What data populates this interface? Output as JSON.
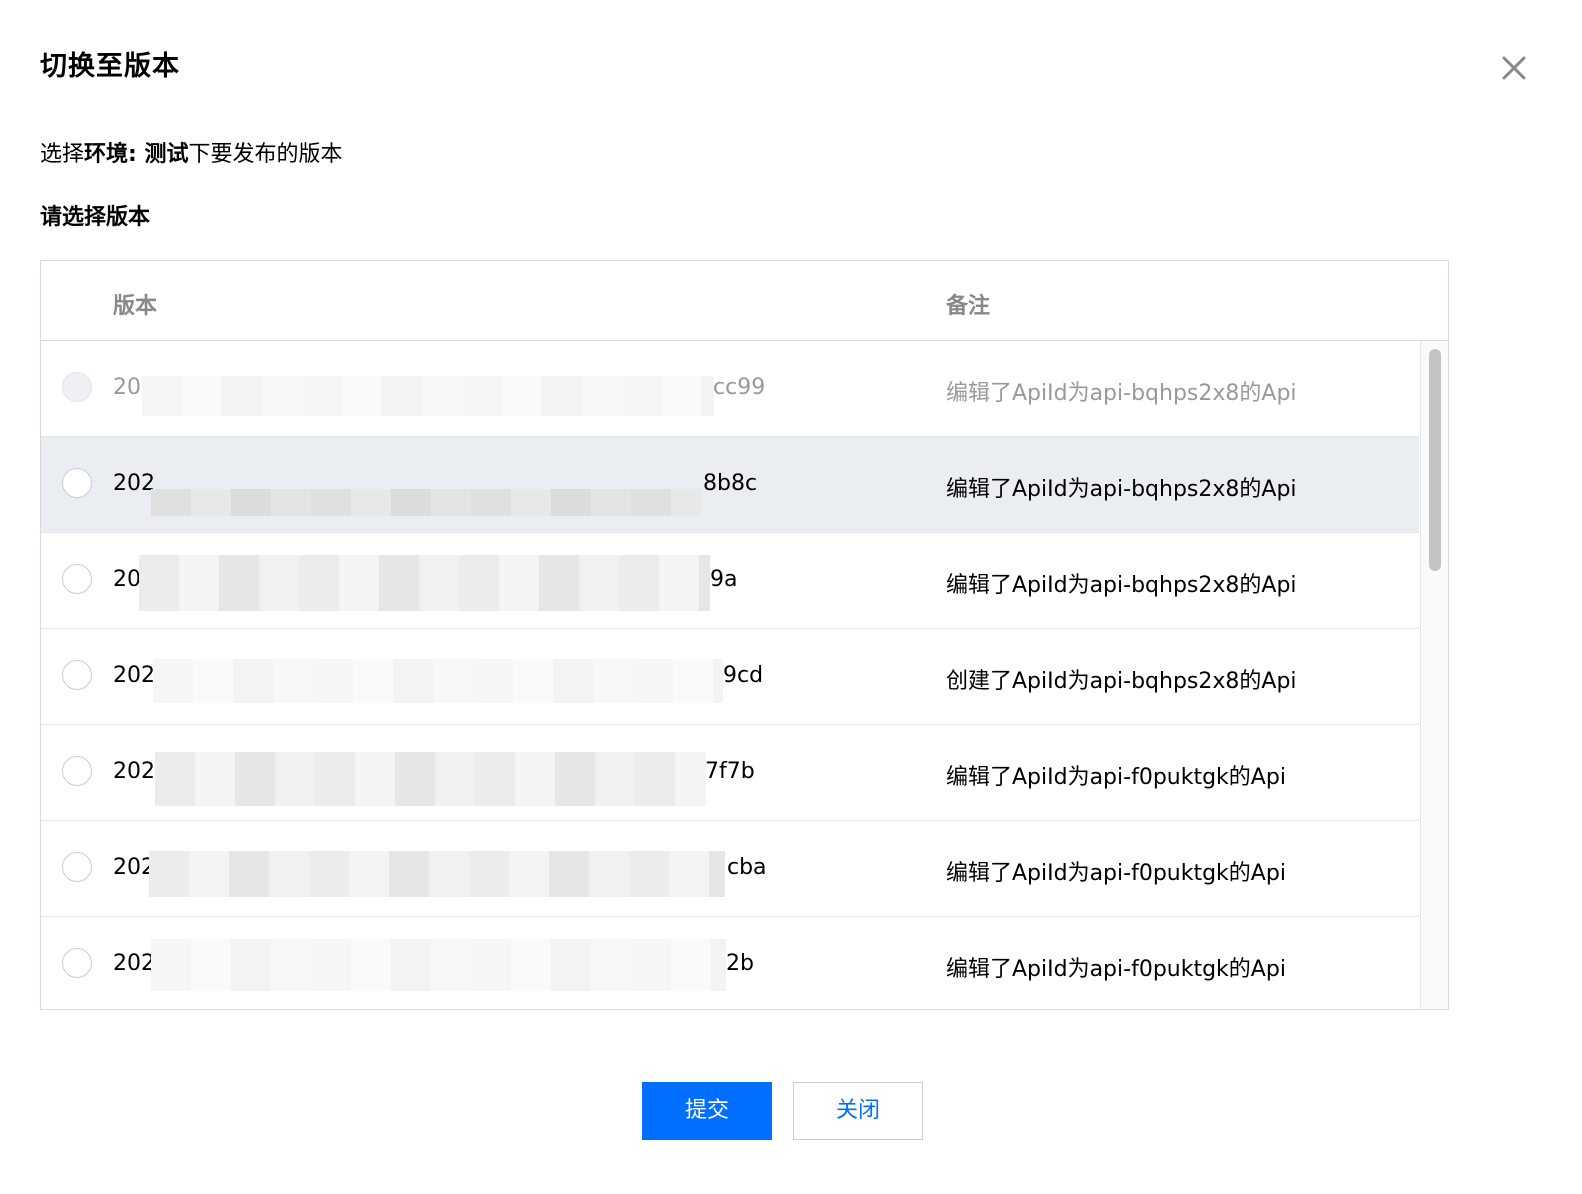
{
  "dialog": {
    "title": "切换至版本",
    "close_icon": "close-icon"
  },
  "description": {
    "prefix": "选择",
    "env_label": "环境: 测试",
    "suffix": "下要发布的版本"
  },
  "section_label": "请选择版本",
  "table": {
    "columns": [
      "版本",
      "备注"
    ],
    "rows": [
      {
        "version_prefix": "20",
        "version_suffix": "cc99",
        "remark": "编辑了ApiId为api-bqhps2x8的Api",
        "disabled": true,
        "hovered": false
      },
      {
        "version_prefix": "202",
        "version_suffix": "8b8c",
        "remark": "编辑了ApiId为api-bqhps2x8的Api",
        "disabled": false,
        "hovered": true
      },
      {
        "version_prefix": "20",
        "version_suffix": "9a",
        "remark": "编辑了ApiId为api-bqhps2x8的Api",
        "disabled": false,
        "hovered": false
      },
      {
        "version_prefix": "202",
        "version_suffix": "9cd",
        "remark": "创建了ApiId为api-bqhps2x8的Api",
        "disabled": false,
        "hovered": false
      },
      {
        "version_prefix": "202",
        "version_suffix": "7f7b",
        "remark": "编辑了ApiId为api-f0puktgk的Api",
        "disabled": false,
        "hovered": false
      },
      {
        "version_prefix": "202",
        "version_suffix": "cba",
        "remark": "编辑了ApiId为api-f0puktgk的Api",
        "disabled": false,
        "hovered": false
      },
      {
        "version_prefix": "202",
        "version_suffix": "2b",
        "remark": "编辑了ApiId为api-f0puktgk的Api",
        "disabled": false,
        "hovered": false
      }
    ]
  },
  "buttons": {
    "submit": "提交",
    "close": "关闭"
  },
  "colors": {
    "primary": "#006eff",
    "hover_row": "#eaedf2",
    "header_text": "#888888",
    "border": "#d6d9e0"
  }
}
